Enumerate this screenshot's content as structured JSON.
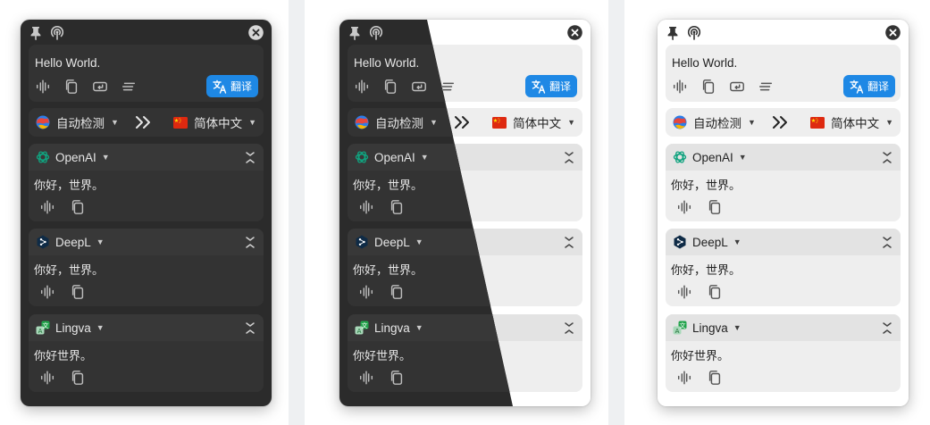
{
  "window": {
    "input_text": "Hello World.",
    "translate_label": "翻译",
    "source_language": "自动检测",
    "target_language": "简体中文",
    "services": [
      {
        "name": "OpenAI",
        "result": "你好，世界。",
        "logo": "openai-logo",
        "color": "#10a37f"
      },
      {
        "name": "DeepL",
        "result": "你好，世界。",
        "logo": "deepl-logo",
        "color": "#0f2b46"
      },
      {
        "name": "Lingva",
        "result": "你好世界。",
        "logo": "lingva-logo",
        "color": "#22a34b"
      }
    ]
  },
  "icons": {
    "pin": "pin-icon",
    "signal": "broadcast-icon",
    "close": "close-icon",
    "speak": "waveform-icon",
    "copy": "copy-icon",
    "delete_newline": "return-icon",
    "clean": "lines-icon",
    "swap": "double-chevron-right-icon",
    "collapse": "expand-collapse-icon"
  },
  "theme": {
    "accent": "#1e88e5",
    "dark_bg": "#2b2b2b",
    "light_bg": "#ffffff"
  }
}
